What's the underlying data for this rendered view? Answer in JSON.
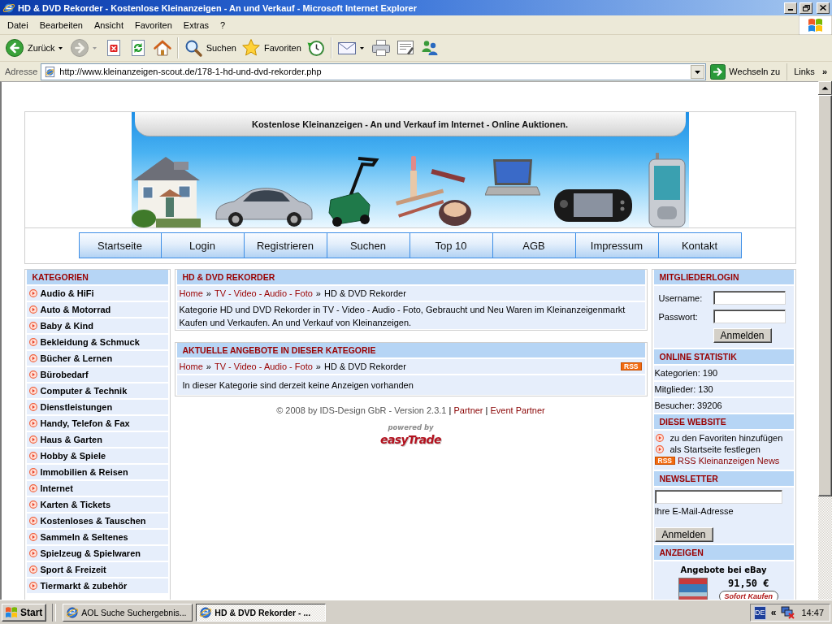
{
  "window": {
    "title": "HD & DVD Rekorder - Kostenlose Kleinanzeigen - An und Verkauf - Microsoft Internet Explorer"
  },
  "menu": [
    "Datei",
    "Bearbeiten",
    "Ansicht",
    "Favoriten",
    "Extras",
    "?"
  ],
  "toolbar": [
    {
      "kind": "back",
      "label": "Zurück",
      "dropdown": true,
      "disabled": false
    },
    {
      "kind": "forward",
      "dropdown": true,
      "disabled": true
    },
    {
      "kind": "stop",
      "dropdown": false,
      "disabled": false
    },
    {
      "kind": "refresh",
      "dropdown": false,
      "disabled": false
    },
    {
      "kind": "home",
      "dropdown": false,
      "disabled": false
    },
    {
      "kind": "separator"
    },
    {
      "kind": "search",
      "label": "Suchen",
      "dropdown": false,
      "disabled": false
    },
    {
      "kind": "favorites",
      "label": "Favoriten",
      "dropdown": false,
      "disabled": false
    },
    {
      "kind": "history",
      "dropdown": false,
      "disabled": false
    },
    {
      "kind": "separator"
    },
    {
      "kind": "mail",
      "dropdown": true,
      "disabled": false
    },
    {
      "kind": "print",
      "dropdown": false,
      "disabled": false
    },
    {
      "kind": "edit",
      "dropdown": false,
      "disabled": false
    },
    {
      "kind": "messenger",
      "dropdown": false,
      "disabled": false
    }
  ],
  "address_bar": {
    "label": "Adresse",
    "url": "http://www.kleinanzeigen-scout.de/178-1-hd-und-dvd-rekorder.php",
    "go": "Wechseln zu",
    "links": "Links",
    "links_chevron": "»"
  },
  "banner": {
    "title": "Kostenlose Kleinanzeigen - An und Verkauf im Internet - Online Auktionen."
  },
  "nav": [
    "Startseite",
    "Login",
    "Registrieren",
    "Suchen",
    "Top 10",
    "AGB",
    "Impressum",
    "Kontakt"
  ],
  "categories": {
    "title": "KATEGORIEN",
    "items": [
      "Audio & HiFi",
      "Auto & Motorrad",
      "Baby & Kind",
      "Bekleidung & Schmuck",
      "Bücher & Lernen",
      "Bürobedarf",
      "Computer & Technik",
      "Dienstleistungen",
      "Handy, Telefon & Fax",
      "Haus & Garten",
      "Hobby & Spiele",
      "Immobilien & Reisen",
      "Internet",
      "Karten & Tickets",
      "Kostenloses & Tauschen",
      "Sammeln & Seltenes",
      "Spielzeug & Spielwaren",
      "Sport & Freizeit",
      "Tiermarkt & zubehör"
    ]
  },
  "sections": [
    {
      "title": "HD & DVD REKORDER",
      "breadcrumb": [
        {
          "kind": "link",
          "text": "Home"
        },
        {
          "kind": "separator",
          "text": "»"
        },
        {
          "kind": "link",
          "text": "TV - Video - Audio - Foto"
        },
        {
          "kind": "separator",
          "text": "»"
        },
        {
          "kind": "current",
          "text": "HD & DVD Rekorder"
        }
      ],
      "text": "Kategorie HD und DVD Rekorder in TV - Video - Audio - Foto, Gebraucht und Neu Waren im Kleinanzeigenmarkt Kaufen und Verkaufen. An und Verkauf von Kleinanzeigen."
    },
    {
      "title": "AKTUELLE ANGEBOTE IN DIESER KATEGORIE",
      "breadcrumb": [
        {
          "kind": "link",
          "text": "Home"
        },
        {
          "kind": "separator",
          "text": "»"
        },
        {
          "kind": "link",
          "text": "TV - Video - Audio - Foto"
        },
        {
          "kind": "separator",
          "text": "»"
        },
        {
          "kind": "current",
          "text": "HD & DVD Rekorder"
        }
      ],
      "rss": "RSS",
      "text": "In dieser Kategorie sind derzeit keine Anzeigen vorhanden"
    }
  ],
  "footer": [
    {
      "kind": "text",
      "text": "© 2008 by IDS-Design GbR - Version 2.3.1"
    },
    {
      "kind": "separator",
      "text": "|"
    },
    {
      "kind": "link",
      "text": "Partner"
    },
    {
      "kind": "separator",
      "text": "|"
    },
    {
      "kind": "link",
      "text": "Event Partner"
    }
  ],
  "powered_by": {
    "caption": "powered by",
    "brand": "easyTrade"
  },
  "login": {
    "title": "MITGLIEDERLOGIN",
    "fields": [
      "Username:",
      "Passwort:"
    ],
    "button": "Anmelden"
  },
  "statistics": {
    "title": "ONLINE STATISTIK",
    "rows": [
      "Kategorien: 190",
      "Mitglieder: 130",
      "Besucher: 39206"
    ]
  },
  "website": {
    "title": "DIESE WEBSITE",
    "items": [
      {
        "kind": "bullet",
        "text": "zu den Favoriten hinzufügen"
      },
      {
        "kind": "bullet",
        "text": "als Startseite festlegen"
      },
      {
        "kind": "rss",
        "badge": "RSS",
        "text": "RSS Kleinanzeigen News"
      }
    ]
  },
  "newsletter": {
    "title": "NEWSLETTER",
    "hint": "Ihre E-Mail-Adresse",
    "button": "Anmelden"
  },
  "ads": {
    "title": "ANZEIGEN",
    "heading": "Angebote bei eBay",
    "price": "91,50 €",
    "button": "Sofort Kaufen"
  },
  "taskbar": {
    "start": "Start",
    "tasks": [
      {
        "label": "AOL Suche Suchergebnis...",
        "selected": false
      },
      {
        "label": "HD & DVD Rekorder - ...",
        "selected": true
      }
    ],
    "language": "DE",
    "chevron": "«",
    "clock": "14:47"
  }
}
